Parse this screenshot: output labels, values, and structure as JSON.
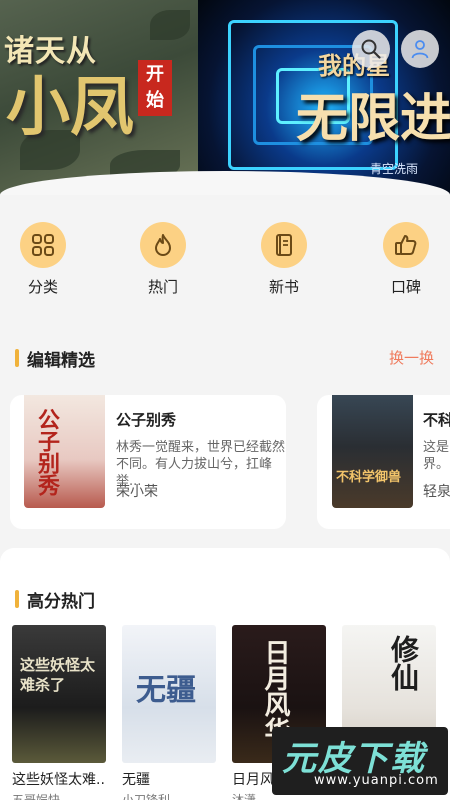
{
  "banner": {
    "slides": [
      {
        "title_top": "诸天从",
        "title_big": "小凤",
        "badge": "开始"
      },
      {
        "title_top": "我的星",
        "title_big": "无限进",
        "author": "青空洗雨"
      }
    ],
    "colors": {
      "search_btn_bg": "#ebebeb"
    }
  },
  "header_icons": {
    "search": "search-icon",
    "user": "user-icon"
  },
  "categories": [
    {
      "label": "分类",
      "icon": "grid-icon"
    },
    {
      "label": "热门",
      "icon": "flame-icon"
    },
    {
      "label": "新书",
      "icon": "book-icon"
    },
    {
      "label": "口碑",
      "icon": "thumbs-up-icon"
    }
  ],
  "editor_picks": {
    "title": "编辑精选",
    "more": "换一换",
    "books": [
      {
        "name": "公子别秀",
        "desc": "林秀一觉醒来，世界已经截然不同。有人力拔山兮，扛峰举...",
        "author": "荣小荣",
        "cover_text": "公子别秀"
      },
      {
        "name": "不科",
        "desc": "这是界。",
        "author": "轻泉",
        "cover_text": "不科学御兽"
      }
    ]
  },
  "hot": {
    "title": "高分热门",
    "books": [
      {
        "name": "这些妖怪太难...",
        "sub": "五哥娱快",
        "cover_text": "这些妖怪太难杀了"
      },
      {
        "name": "无疆",
        "sub": "小刀锋利",
        "cover_text": "无疆"
      },
      {
        "name": "日月风华",
        "sub": "沐潇",
        "cover_text": "日月风华"
      },
      {
        "name": "修仙",
        "sub": "",
        "cover_text": "修仙"
      }
    ]
  },
  "watermark": {
    "logo": "元皮下载",
    "url": "www.yuanpi.com"
  },
  "accent_colors": {
    "section_bar": "#f0b23b",
    "more_link": "#f07b5d",
    "icon_bg": "#fcd184"
  }
}
